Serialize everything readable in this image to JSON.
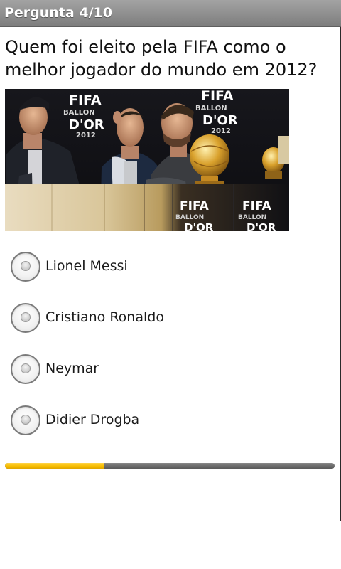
{
  "header": {
    "title": "Pergunta 4/10"
  },
  "question": {
    "text": "Quem foi eleito pela FIFA como o melhor jogador do mundo em 2012?"
  },
  "photo": {
    "signage": {
      "fifa": "FIFA",
      "ballon": "BALLON",
      "dor": "D'OR",
      "year": "2012"
    }
  },
  "options": [
    {
      "label": "Lionel Messi",
      "selected": false
    },
    {
      "label": "Cristiano Ronaldo",
      "selected": false
    },
    {
      "label": "Neymar",
      "selected": false
    },
    {
      "label": "Didier Drogba",
      "selected": false
    }
  ],
  "progress": {
    "fraction": 0.3,
    "fill_color": "#f7bd00",
    "track_color": "#6c6c6c"
  }
}
